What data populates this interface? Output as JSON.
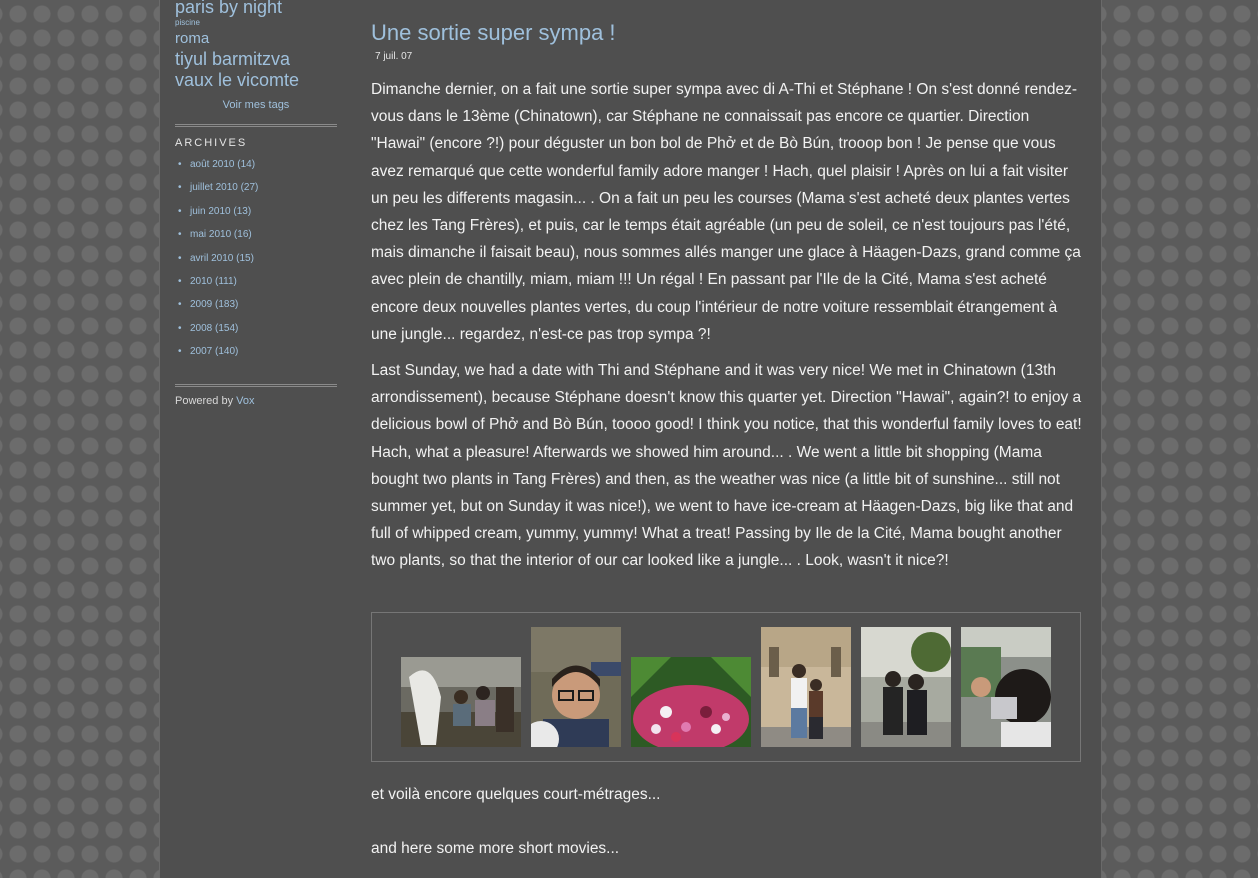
{
  "sidebar": {
    "tags": [
      "paris by night",
      "piscine",
      "roma",
      "tiyul barmitzva",
      "vaux le vicomte"
    ],
    "see_tags_label": "Voir mes tags",
    "archives_title": "ARCHIVES",
    "archives": [
      {
        "label": "août 2010",
        "count": "(14)"
      },
      {
        "label": "juillet 2010",
        "count": "(27)"
      },
      {
        "label": "juin 2010",
        "count": "(13)"
      },
      {
        "label": "mai 2010",
        "count": "(16)"
      },
      {
        "label": "avril 2010",
        "count": "(15)"
      },
      {
        "label": "2010",
        "count": "(111)"
      },
      {
        "label": "2009",
        "count": "(183)"
      },
      {
        "label": "2008",
        "count": "(154)"
      },
      {
        "label": "2007",
        "count": "(140)"
      }
    ],
    "bullet": "•",
    "powered_text": "Powered by",
    "powered_link": "Vox"
  },
  "post": {
    "title": "Une sortie super sympa !",
    "date": "7 juil. 07",
    "paragraph_fr": "Dimanche dernier, on a fait une sortie super sympa avec di A-Thi et Stéphane ! On s'est donné rendez-vous dans le 13ème (Chinatown), car Stéphane ne connaissait pas encore ce quartier. Direction \"Hawai\" (encore ?!) pour déguster un bon bol de Phở et de Bò Bún, trooop bon ! Je pense que vous avez remarqué que cette wonderful family adore manger ! Hach, quel plaisir ! Après on lui a fait visiter un peu les differents magasin... . On a fait un peu les courses (Mama s'est acheté deux plantes vertes chez les Tang Frères), et puis, car le temps était agréable (un peu de soleil, ce n'est toujours pas l'été, mais dimanche il faisait beau), nous sommes allés manger une glace à Häagen-Dazs, grand comme ça avec plein de chantilly, miam, miam !!! Un régal ! En passant par l'Ile de la Cité, Mama s'est acheté encore deux nouvelles plantes vertes, du coup l'intérieur de notre voiture ressemblait étrangement à une jungle... regardez, n'est-ce pas trop sympa ?!",
    "paragraph_en": "Last Sunday, we had a date with Thi and Stéphane and it was very nice! We met in Chinatown (13th arrondissement), because Stéphane doesn't know this quarter yet. Direction \"Hawai\", again?! to enjoy a delicious bowl of Phở and Bò Bún, toooo good! I think you notice, that this wonderful family loves to eat! Hach, what a pleasure! Afterwards we showed him around... . We went a little bit shopping (Mama bought two plants in Tang Frères) and then, as the weather was nice (a little bit of sunshine... still not summer yet, but on Sunday it was nice!), we went to have ice-cream at Häagen-Dazs, big like that and full of whipped cream, yummy, yummy! What a treat! Passing by Ile de la Cité, Mama bought another two plants, so that the interior of our car looked like a jungle... . Look, wasn't it nice?!",
    "caption_fr": "et voilà encore quelques court-métrages...",
    "caption_en": "and here some more short movies..."
  },
  "photos": [
    {
      "name": "photo-people-sitting-icon"
    },
    {
      "name": "photo-boy-glasses-icon"
    },
    {
      "name": "photo-flower-bed-icon"
    },
    {
      "name": "photo-couple-street-icon"
    },
    {
      "name": "photo-two-women-icon"
    },
    {
      "name": "photo-woman-camera-icon"
    }
  ],
  "colors": {
    "link": "#9fc0dc",
    "page_bg": "#4f4f4f",
    "outer_bg": "#5b5b5b"
  }
}
